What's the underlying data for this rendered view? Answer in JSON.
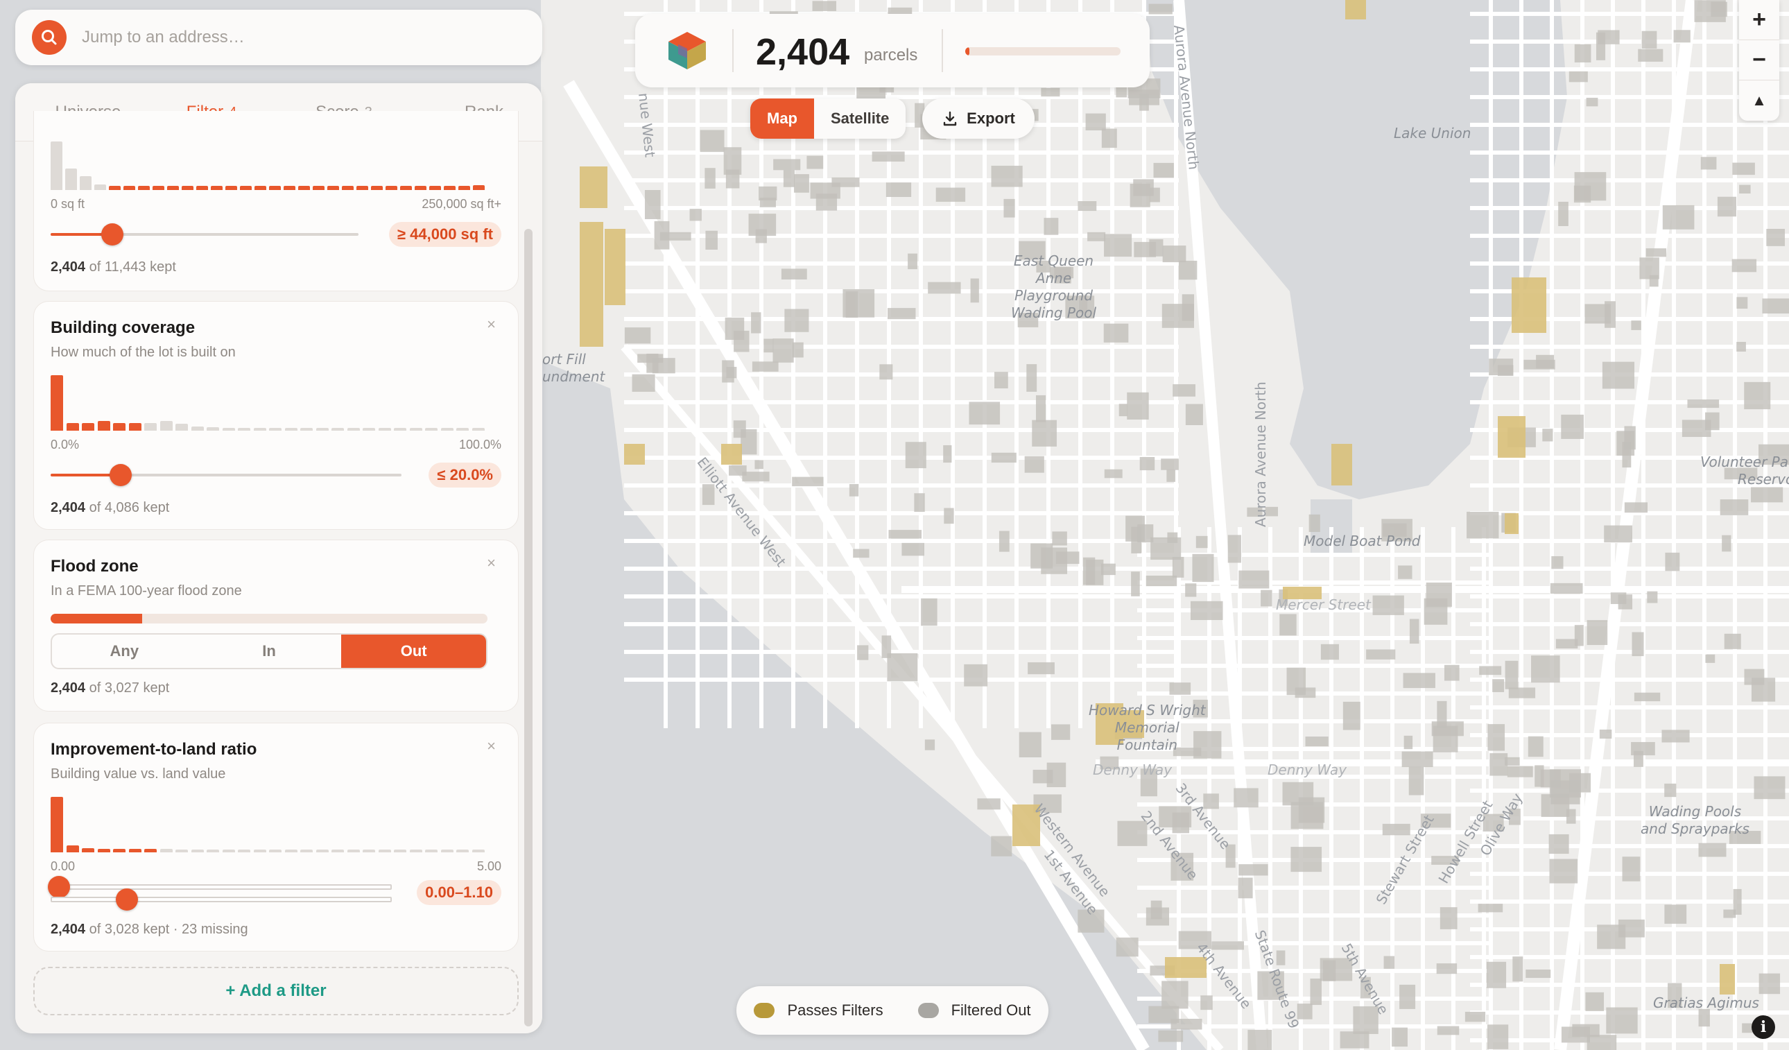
{
  "search": {
    "placeholder": "Jump to an address…"
  },
  "tabs": [
    {
      "label": "Universe",
      "count": ""
    },
    {
      "label": "Filter",
      "count": "4"
    },
    {
      "label": "Score",
      "count": "3"
    },
    {
      "label": "Rank",
      "count": ""
    }
  ],
  "filters": {
    "lot_size": {
      "axis_min": "0 sq ft",
      "axis_max": "250,000 sq ft+",
      "value": "≥ 44,000 sq ft",
      "slider_fraction": 0.2,
      "kept_count": "2,404",
      "kept_rest": " of 11,443 kept",
      "histogram": [
        1.0,
        0.45,
        0.28,
        0.12,
        0.08,
        0.08,
        0.08,
        0.08,
        0.08,
        0.08,
        0.08,
        0.08,
        0.08,
        0.08,
        0.08,
        0.08,
        0.08,
        0.08,
        0.08,
        0.08,
        0.08,
        0.08,
        0.08,
        0.08,
        0.08,
        0.08,
        0.08,
        0.08,
        0.08,
        0.1
      ],
      "selected_from_bin": 4
    },
    "building_coverage": {
      "title": "Building coverage",
      "subtitle": "How much of the lot is built on",
      "close": "×",
      "axis_min": "0.0%",
      "axis_max": "100.0%",
      "value": "≤ 20.0%",
      "slider_fraction": 0.2,
      "kept_count": "2,404",
      "kept_rest": " of 4,086 kept",
      "histogram": [
        1.0,
        0.14,
        0.14,
        0.17,
        0.14,
        0.14,
        0.14,
        0.17,
        0.12,
        0.08,
        0.06,
        0.05,
        0.05,
        0.05,
        0.05,
        0.05,
        0.05,
        0.05,
        0.05,
        0.05,
        0.05,
        0.05,
        0.05,
        0.05,
        0.05,
        0.05,
        0.05,
        0.05
      ],
      "selected_to_bin": 5
    },
    "flood_zone": {
      "title": "Flood zone",
      "subtitle": "In a FEMA 100-year flood zone",
      "close": "×",
      "bar_fraction": 0.21,
      "options": [
        "Any",
        "In",
        "Out"
      ],
      "selected": "Out",
      "kept_count": "2,404",
      "kept_rest": " of 3,027 kept"
    },
    "improvement_ratio": {
      "title": "Improvement-to-land ratio",
      "subtitle": "Building value vs. land value",
      "close": "×",
      "axis_min": "0.00",
      "axis_max": "5.00",
      "value": "0.00–1.10",
      "range_min_fraction": 0.0,
      "range_max_fraction": 0.22,
      "kept_count": "2,404",
      "kept_rest": " of 3,028 kept · 23 missing",
      "histogram": [
        1.0,
        0.12,
        0.07,
        0.06,
        0.06,
        0.06,
        0.06,
        0.06,
        0.05,
        0.05,
        0.05,
        0.05,
        0.05,
        0.05,
        0.05,
        0.05,
        0.05,
        0.05,
        0.05,
        0.05,
        0.05,
        0.05,
        0.05,
        0.05,
        0.05,
        0.05,
        0.05,
        0.05
      ],
      "selected_to_bin": 6
    }
  },
  "add_filter": "+ Add a filter",
  "stats": {
    "count": "2,404",
    "label": "parcels",
    "fraction": 0.02
  },
  "map_toggle": {
    "map": "Map",
    "satellite": "Satellite",
    "selected": "Map"
  },
  "export": "Export",
  "zoom": {
    "in": "+",
    "out": "−",
    "north": "▲"
  },
  "legend": [
    {
      "label": "Passes Filters",
      "color": "#b8993a"
    },
    {
      "label": "Filtered Out",
      "color": "#a8a6a2"
    }
  ],
  "info": "i",
  "map_labels": {
    "lake_union": "Lake Union",
    "east_queen_anne": [
      "East Queen",
      "Anne",
      "Playground",
      "Wading Pool"
    ],
    "model_boat_pond": "Model Boat Pond",
    "mercer_street": "Mercer Street",
    "howard_wright": [
      "Howard S Wright",
      "Memorial",
      "Fountain"
    ],
    "denny_way_1": "Denny Way",
    "denny_way_2": "Denny Way",
    "volunteer": [
      "Volunteer Pa",
      "Reservoir"
    ],
    "wading_pools": [
      "Wading Pools",
      "and Sprayparks"
    ],
    "gratias": "Gratias Agimus",
    "fort_fill": [
      "ort Fill",
      "undment"
    ],
    "aurora_north": "Aurora Avenue North",
    "aurora_north_2": "Aurora Avenue North",
    "elliott_west": "Elliott Avenue West",
    "nue_west": "nue West",
    "state_route": "State Route 99",
    "avenue_4th": "4th Avenue",
    "avenue_5th": "5th Avenue",
    "western": "Western Avenue",
    "first": "1st Avenue",
    "second": "2nd Avenue",
    "third": "3rd Avenue",
    "stewart": "Stewart Street",
    "howell": "Howell Street",
    "olive": "Olive Way"
  },
  "colors": {
    "accent": "#e8572c",
    "pass": "#d9c07a",
    "out": "#c2bfba",
    "water": "#d7d9dc"
  }
}
